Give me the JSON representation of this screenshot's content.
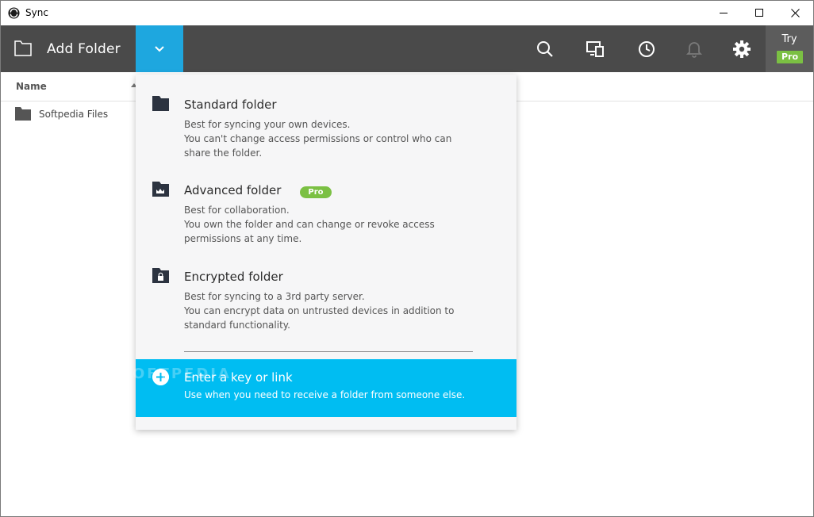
{
  "window": {
    "title": "Sync"
  },
  "toolbar": {
    "add_folder_label": "Add Folder",
    "try_label": "Try",
    "pro_badge": "Pro",
    "icons": [
      "search-icon",
      "devices-icon",
      "history-icon",
      "bell-icon",
      "gear-icon"
    ]
  },
  "columns": {
    "name": "Name"
  },
  "files": [
    {
      "name": "Softpedia Files"
    }
  ],
  "menu": {
    "items": [
      {
        "title": "Standard folder",
        "lines": [
          "Best for syncing your own devices.",
          "You can't change access permissions or control who can",
          "share the folder."
        ]
      },
      {
        "title": "Advanced folder",
        "badge": "Pro",
        "lines": [
          "Best for collaboration.",
          "You own the folder and can change or revoke access",
          "permissions at any time."
        ]
      },
      {
        "title": "Encrypted folder",
        "lines": [
          "Best for syncing to a 3rd party server.",
          "You can encrypt data on untrusted devices in addition to",
          "standard functionality."
        ]
      }
    ],
    "key_link": {
      "title": "Enter a key or link",
      "description": "Use when you need to receive a folder from someone else."
    }
  },
  "watermark": "SOFTPEDIA",
  "colors": {
    "toolbar_bg": "#4a4a4a",
    "accent_blue": "#1ea7df",
    "highlight_cyan": "#00bdf2",
    "pro_green": "#7bc043",
    "menu_bg": "#f6f6f7"
  }
}
